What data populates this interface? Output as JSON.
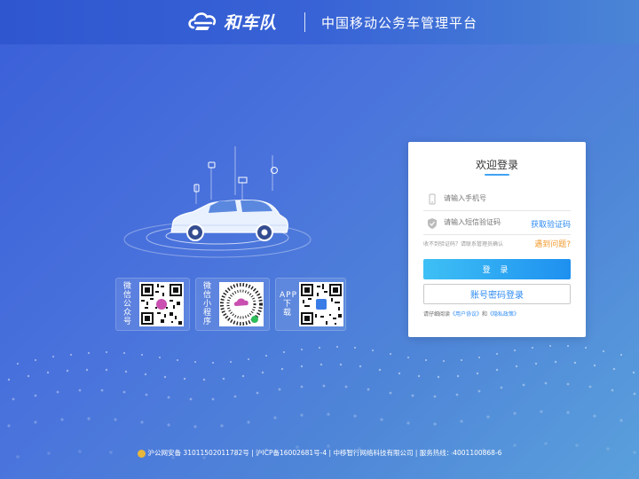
{
  "header": {
    "brand_name": "和车队",
    "title": "中国移动公务车管理平台"
  },
  "qr_codes": [
    {
      "label": "微信公众号",
      "icon": "wechat-official-account-qr"
    },
    {
      "label": "微信小程序",
      "icon": "wechat-mini-program-qr"
    },
    {
      "label": "APP下载",
      "icon": "app-download-qr"
    }
  ],
  "login": {
    "title": "欢迎登录",
    "phone_placeholder": "请输入手机号",
    "code_placeholder": "请输入短信验证码",
    "get_code": "获取验证码",
    "hint": "收不到验证码？请联系管理员确认",
    "problem": "遇到问题?",
    "submit": "登 录",
    "password_login": "账号密码登录",
    "agree_prefix": "请仔细阅读",
    "user_agreement": "《用户协议》",
    "and": "和",
    "privacy_policy": "《隐私政策》"
  },
  "footer": {
    "text": "沪公网安备 31011502011782号 | 沪ICP备16002681号-4 | 中移智行网络科技有限公司 | 服务热线：4001100868-6"
  },
  "colors": {
    "accent": "#2f8bf2",
    "warning": "#f29a2e",
    "background": "#4a73dc"
  }
}
